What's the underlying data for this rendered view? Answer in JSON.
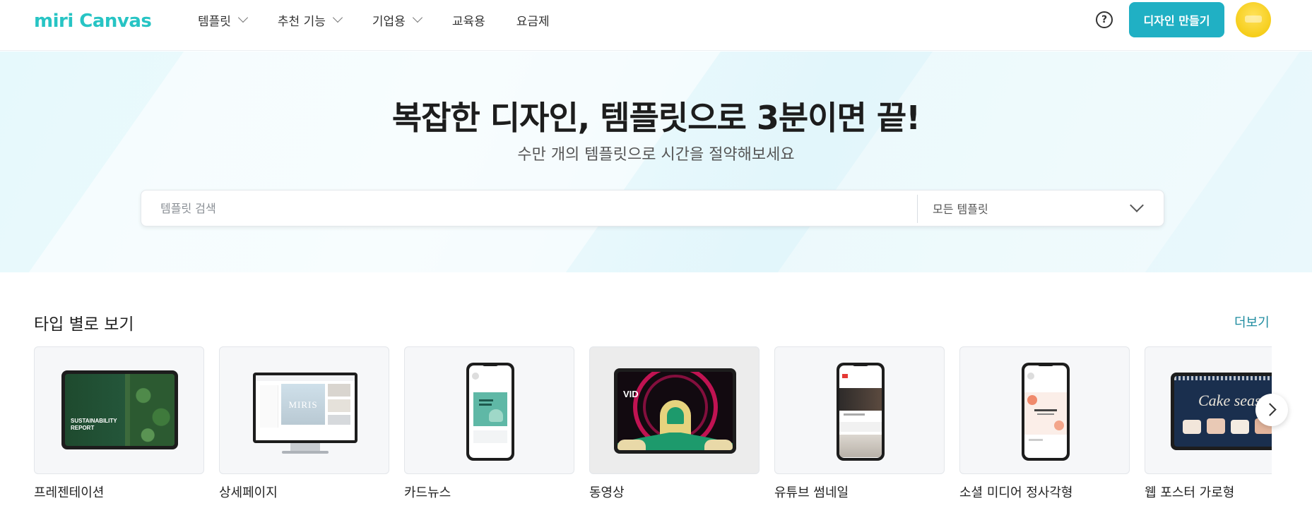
{
  "header": {
    "logo_text": "miri Canvas",
    "nav": [
      {
        "label": "템플릿",
        "has_dropdown": true
      },
      {
        "label": "추천 기능",
        "has_dropdown": true
      },
      {
        "label": "기업용",
        "has_dropdown": true
      },
      {
        "label": "교육용",
        "has_dropdown": false
      },
      {
        "label": "요금제",
        "has_dropdown": false
      }
    ],
    "help_icon": "?",
    "cta_label": "디자인 만들기"
  },
  "hero": {
    "title": "복잡한 디자인, 템플릿으로 3분이면 끝!",
    "subtitle": "수만 개의 템플릿으로 시간을 절약해보세요",
    "search_placeholder": "템플릿 검색",
    "search_value": "",
    "filter_selected": "모든 템플릿"
  },
  "section": {
    "title": "타입 별로 보기",
    "more_label": "더보기",
    "cards": [
      {
        "label": "프레젠테이션",
        "thumb_text": "SUSTAINABILITY REPORT"
      },
      {
        "label": "상세페이지",
        "thumb_text": "MIRIS"
      },
      {
        "label": "카드뉴스",
        "thumb_text": ""
      },
      {
        "label": "동영상",
        "thumb_text": "VID"
      },
      {
        "label": "유튜브 썸네일",
        "thumb_text": ""
      },
      {
        "label": "소셜 미디어 정사각형",
        "thumb_text": ""
      },
      {
        "label": "웹 포스터 가로형",
        "thumb_text": "Cake seas"
      }
    ]
  },
  "colors": {
    "brand": "#27c4c4",
    "cta": "#20b0c4",
    "link": "#1f8ca0"
  }
}
